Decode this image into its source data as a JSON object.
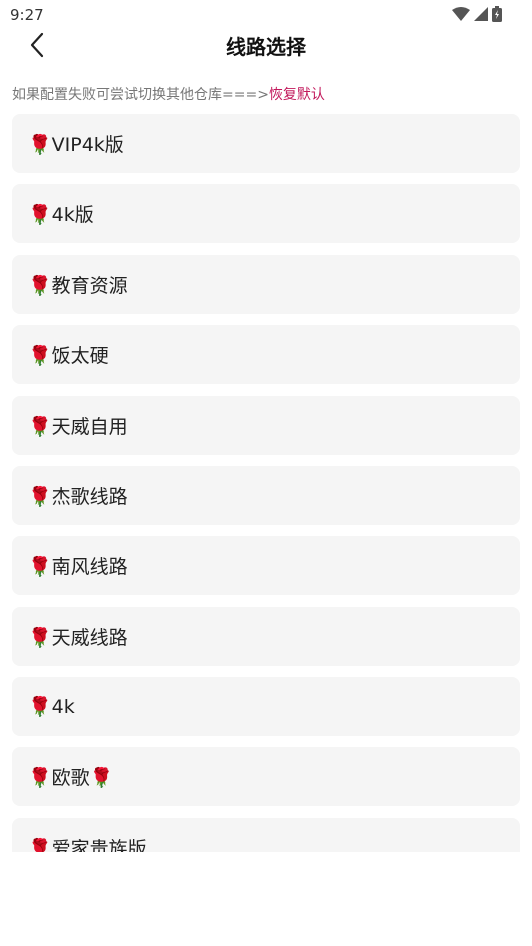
{
  "status": {
    "time": "9:27"
  },
  "header": {
    "title": "线路选择"
  },
  "hint": {
    "text": "如果配置失败可尝试切换其他仓库===>",
    "restore_label": "恢复默认"
  },
  "routes": [
    {
      "label": "🌹VIP4k版"
    },
    {
      "label": "🌹4k版"
    },
    {
      "label": "🌹教育资源"
    },
    {
      "label": "🌹饭太硬"
    },
    {
      "label": "🌹天威自用"
    },
    {
      "label": "🌹杰歌线路"
    },
    {
      "label": "🌹南风线路"
    },
    {
      "label": "🌹天威线路"
    },
    {
      "label": "🌹4k"
    },
    {
      "label": "🌹欧歌🌹"
    },
    {
      "label": "🌹爱家贵族版"
    }
  ],
  "colors": {
    "accent": "#c2185b",
    "item_bg": "#f5f5f5"
  },
  "icons": {
    "back": "chevron-left-icon",
    "wifi": "wifi-icon",
    "signal": "signal-icon",
    "battery": "battery-icon"
  }
}
